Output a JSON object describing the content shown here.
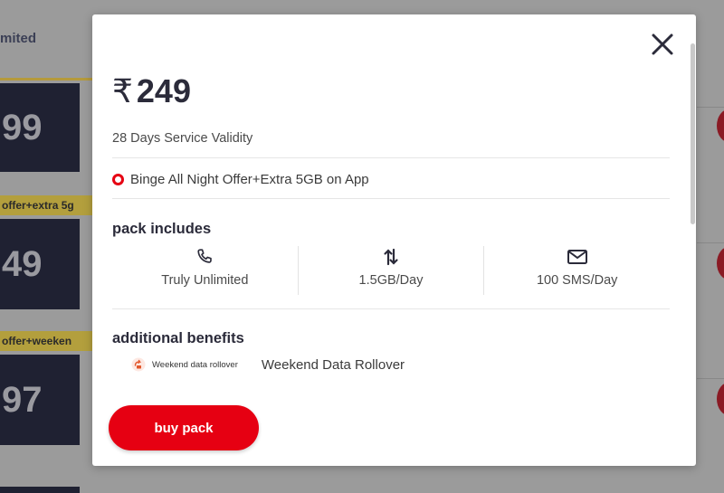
{
  "background": {
    "top_label": "mited",
    "cards": [
      "99",
      "49",
      "97"
    ],
    "tags": [
      "offer+extra 5g",
      "offer+weeken"
    ]
  },
  "modal": {
    "close_icon": "close-icon",
    "currency": "₹",
    "price": "249",
    "validity": "28 Days Service Validity",
    "offer": "Binge All Night Offer+Extra 5GB on App",
    "pack_includes_title": "pack includes",
    "includes": [
      {
        "icon": "phone-icon",
        "label": "Truly Unlimited"
      },
      {
        "icon": "data-arrows-icon",
        "label": "1.5GB/Day"
      },
      {
        "icon": "sms-envelope-icon",
        "label": "100 SMS/Day"
      }
    ],
    "additional_title": "additional benefits",
    "benefit": {
      "icon": "rollover-icon",
      "small_label": "Weekend data rollover",
      "label": "Weekend Data Rollover"
    },
    "buy_label": "buy pack"
  },
  "colors": {
    "accent": "#e60012",
    "text_dark": "#2b2b3a",
    "overlay_bg": "#9b9b9b"
  }
}
